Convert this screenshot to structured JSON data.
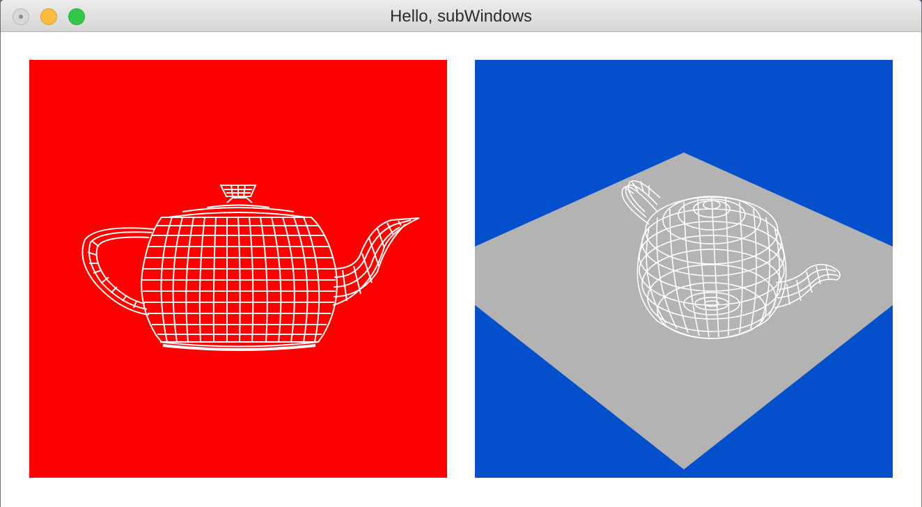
{
  "window": {
    "title": "Hello, subWindows"
  },
  "colors": {
    "left_background": "#ff0000",
    "right_background": "#044fcc",
    "floor": "#b3b3b3",
    "wireframe": "#ffffff"
  },
  "subwindows": [
    {
      "name": "front-view",
      "content": "teapot-wireframe"
    },
    {
      "name": "perspective-view",
      "content": "teapot-wireframe-on-plane"
    }
  ]
}
